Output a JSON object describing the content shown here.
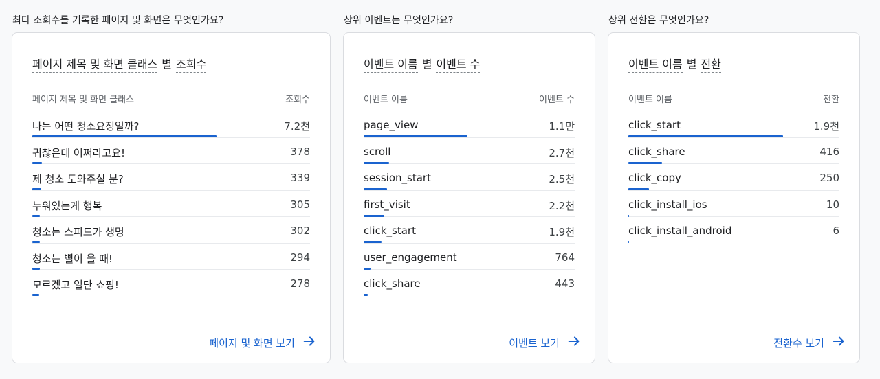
{
  "cards": [
    {
      "question": "최다 조회수를 기록한 페이지 및 화면은 무엇인가요?",
      "title_parts": [
        {
          "text": "페이지 제목 및 화면 클래스",
          "dashed": true
        },
        {
          "text": "별",
          "dashed": false
        },
        {
          "text": "조회수",
          "dashed": true
        }
      ],
      "col_left": "페이지 제목 및 화면 클래스",
      "col_right": "조회수",
      "rows": [
        {
          "name": "나는 어떤 청소요정일까?",
          "value": "7.2천",
          "ratio": 1.0
        },
        {
          "name": "귀찮은데 어쩌라고요!",
          "value": "378",
          "ratio": 0.052
        },
        {
          "name": "제 청소 도와주실 분?",
          "value": "339",
          "ratio": 0.047
        },
        {
          "name": "누워있는게 행복",
          "value": "305",
          "ratio": 0.042
        },
        {
          "name": "청소는 스피드가 생명",
          "value": "302",
          "ratio": 0.042
        },
        {
          "name": "청소는 삘이 올 때!",
          "value": "294",
          "ratio": 0.041
        },
        {
          "name": "모르겠고 일단 쇼핑!",
          "value": "278",
          "ratio": 0.039
        }
      ],
      "link_label": "페이지 및 화면 보기"
    },
    {
      "question": "상위 이벤트는 무엇인가요?",
      "title_parts": [
        {
          "text": "이벤트 이름",
          "dashed": true
        },
        {
          "text": "별",
          "dashed": false
        },
        {
          "text": "이벤트 수",
          "dashed": true
        }
      ],
      "col_left": "이벤트 이름",
      "col_right": "이벤트 수",
      "rows": [
        {
          "name": "page_view",
          "value": "1.1만",
          "ratio": 1.0
        },
        {
          "name": "scroll",
          "value": "2.7천",
          "ratio": 0.245
        },
        {
          "name": "session_start",
          "value": "2.5천",
          "ratio": 0.227
        },
        {
          "name": "first_visit",
          "value": "2.2천",
          "ratio": 0.2
        },
        {
          "name": "click_start",
          "value": "1.9천",
          "ratio": 0.173
        },
        {
          "name": "user_engagement",
          "value": "764",
          "ratio": 0.069
        },
        {
          "name": "click_share",
          "value": "443",
          "ratio": 0.04
        }
      ],
      "link_label": "이벤트 보기"
    },
    {
      "question": "상위 전환은 무엇인가요?",
      "title_parts": [
        {
          "text": "이벤트 이름",
          "dashed": true
        },
        {
          "text": "별",
          "dashed": false
        },
        {
          "text": "전환",
          "dashed": true
        }
      ],
      "col_left": "이벤트 이름",
      "col_right": "전환",
      "rows": [
        {
          "name": "click_start",
          "value": "1.9천",
          "ratio": 1.0
        },
        {
          "name": "click_share",
          "value": "416",
          "ratio": 0.219
        },
        {
          "name": "click_copy",
          "value": "250",
          "ratio": 0.132
        },
        {
          "name": "click_install_ios",
          "value": "10",
          "ratio": 0.005
        },
        {
          "name": "click_install_android",
          "value": "6",
          "ratio": 0.003
        }
      ],
      "link_label": "전환수 보기"
    }
  ],
  "colors": {
    "accent": "#1a63cf",
    "background": "#f8f9fa",
    "card": "#ffffff",
    "border": "#dadce0",
    "muted_text": "#5f6368"
  },
  "icons": {
    "link_arrow": "arrow-right-icon"
  }
}
